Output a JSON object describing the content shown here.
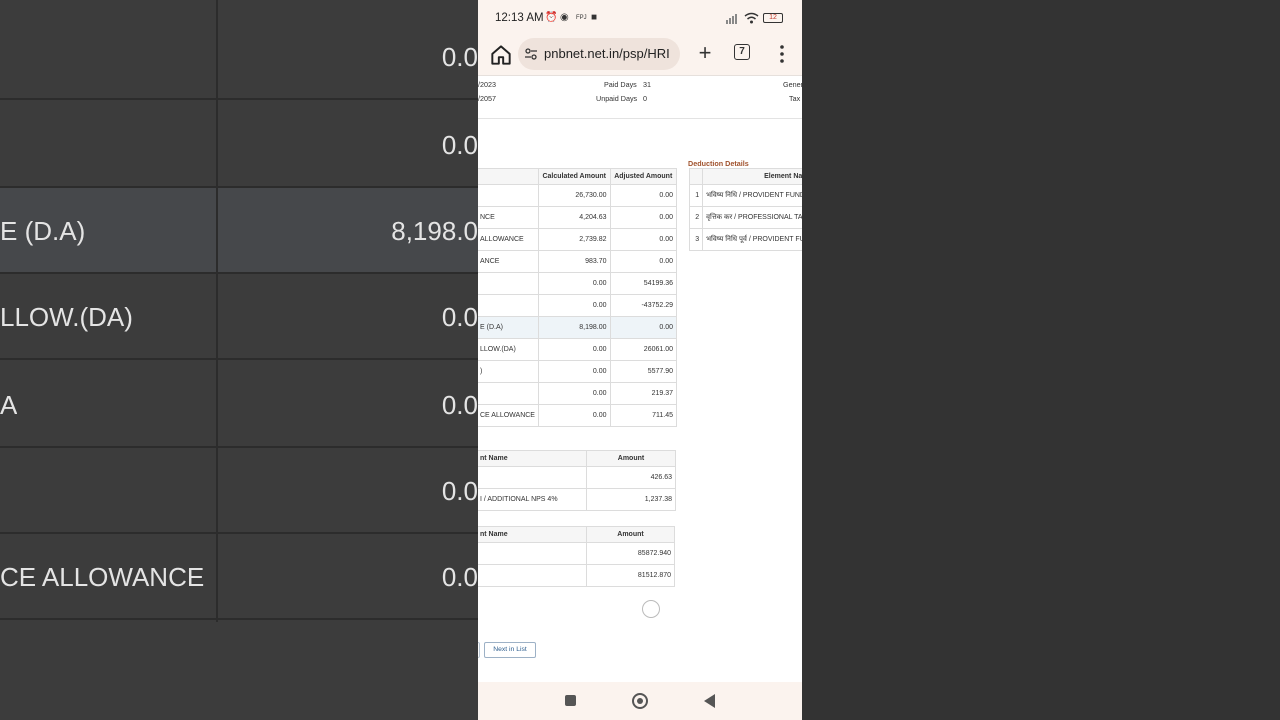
{
  "status_bar": {
    "time": "12:13 AM",
    "battery": "12"
  },
  "browser": {
    "url": "pnbnet.net.in/psp/HRI",
    "tab_count": "7"
  },
  "header_info": {
    "left_vals": [
      "/2023",
      "/2057"
    ],
    "labels": [
      "Paid Days",
      "Unpaid Days"
    ],
    "values": [
      "31",
      "0"
    ],
    "right_labels": [
      "Gener",
      "Tax"
    ]
  },
  "earnings_table": {
    "headers": [
      "",
      "Calculated Amount",
      "Adjusted Amount"
    ],
    "rows": [
      [
        "",
        "26,730.00",
        "0.00"
      ],
      [
        "NCE",
        "4,204.63",
        "0.00"
      ],
      [
        "ALLOWANCE",
        "2,739.82",
        "0.00"
      ],
      [
        "ANCE",
        "983.70",
        "0.00"
      ],
      [
        "",
        "0.00",
        "54199.36"
      ],
      [
        "",
        "0.00",
        "-43752.29"
      ],
      [
        "E (D.A)",
        "8,198.00",
        "0.00"
      ],
      [
        "LLOW.(DA)",
        "0.00",
        "26061.00"
      ],
      [
        ")",
        "0.00",
        "5577.90"
      ],
      [
        "",
        "0.00",
        "219.37"
      ],
      [
        "CE ALLOWANCE",
        "0.00",
        "711.45"
      ]
    ]
  },
  "deduction": {
    "title": "Deduction Details",
    "headers": [
      "",
      "Element Nar"
    ],
    "rows": [
      [
        "1",
        "भविष्य निधि / PROVIDENT FUND"
      ],
      [
        "2",
        "वृत्तिक कर / PROFESSIONAL TA"
      ],
      [
        "3",
        "भविष्य निधि पूर्व / PROVIDENT FU"
      ]
    ]
  },
  "table2": {
    "headers": [
      "nt Name",
      "Amount"
    ],
    "rows": [
      [
        "",
        "426.63"
      ],
      [
        "I / ADDITIONAL NPS 4%",
        "1,237.38"
      ]
    ]
  },
  "table3": {
    "headers": [
      "nt Name",
      "Amount"
    ],
    "rows": [
      [
        "",
        "85872.940"
      ],
      [
        "",
        "81512.870"
      ]
    ]
  },
  "buttons": {
    "next_in_list": "Next in List"
  },
  "background_zoom": {
    "rows": [
      {
        "name": "",
        "value": "0.0"
      },
      {
        "name": "",
        "value": "0.0"
      },
      {
        "name": "E (D.A)",
        "value": "8,198.0"
      },
      {
        "name": "LLOW.(DA)",
        "value": "0.0"
      },
      {
        "name": "A",
        "value": "0.0"
      },
      {
        "name": "",
        "value": "0.0"
      },
      {
        "name": "CE ALLOWANCE",
        "value": "0.0"
      }
    ]
  },
  "colors": {
    "accent_link": "#2f5f8f",
    "deduction_title": "#a0522d",
    "chrome_bg": "#fbf3ee"
  }
}
